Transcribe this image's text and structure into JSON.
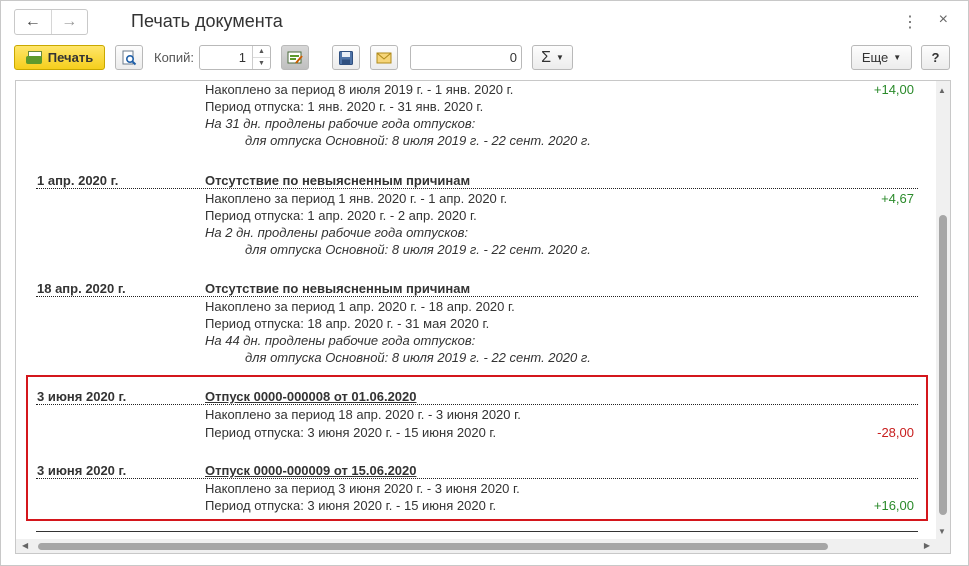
{
  "window": {
    "title": "Печать документа",
    "back_icon": "←",
    "forward_icon": "→",
    "more_icon": "⋮",
    "close_icon": "×"
  },
  "toolbar": {
    "print_label": "Печать",
    "copies_label": "Копий:",
    "copies_value": "1",
    "sum_value": "0",
    "sigma_label": "Σ",
    "more_label": "Еще",
    "help_label": "?"
  },
  "entries": [
    {
      "date": "",
      "title": "",
      "lines": [
        {
          "text": "Накоплено за период 8 июля 2019 г. - 1 янв. 2020 г.",
          "italic": false
        },
        {
          "text": "Период отпуска: 1 янв. 2020 г. - 31 янв. 2020 г.",
          "italic": false
        },
        {
          "text": "На 31 дн. продлены рабочие года отпусков:",
          "italic": true
        },
        {
          "text": "для отпуска Основной: 8 июля 2019 г. - 22 сент. 2020 г.",
          "italic": true
        }
      ],
      "amount": "+14,00"
    },
    {
      "date": "1 апр. 2020 г.",
      "title": "Отсутствие по невыясненным причинам",
      "lines": [
        {
          "text": "Накоплено за период 1 янв. 2020 г. - 1 апр. 2020 г.",
          "italic": false
        },
        {
          "text": "Период отпуска: 1 апр. 2020 г. - 2 апр. 2020 г.",
          "italic": false
        },
        {
          "text": "На 2 дн. продлены рабочие года отпусков:",
          "italic": true
        },
        {
          "text": "для отпуска Основной: 8 июля 2019 г. - 22 сент. 2020 г.",
          "italic": true
        }
      ],
      "amount": "+4,67"
    },
    {
      "date": "18 апр. 2020 г.",
      "title": "Отсутствие по невыясненным причинам",
      "lines": [
        {
          "text": "Накоплено за период 1 апр. 2020 г. - 18 апр. 2020 г.",
          "italic": false
        },
        {
          "text": "Период отпуска: 18 апр. 2020 г. - 31 мая 2020 г.",
          "italic": false
        },
        {
          "text": "На 44 дн. продлены рабочие года отпусков:",
          "italic": true
        },
        {
          "text": "для отпуска Основной: 8 июля 2019 г. - 22 сент. 2020 г.",
          "italic": true
        }
      ],
      "amount": ""
    },
    {
      "date": "3 июня 2020 г.",
      "title": "Отпуск 0000-000008 от 01.06.2020",
      "lines": [
        {
          "text": "Накоплено за период 18 апр. 2020 г. - 3 июня 2020 г.",
          "italic": false
        },
        {
          "text": "Период отпуска: 3 июня 2020 г. - 15 июня 2020 г.",
          "italic": false
        }
      ],
      "amount": "-28,00"
    },
    {
      "date": "3 июня 2020 г.",
      "title": "Отпуск 0000-000009 от 15.06.2020",
      "lines": [
        {
          "text": "Накоплено за период 3 июня 2020 г. - 3 июня 2020 г.",
          "italic": false
        },
        {
          "text": "Период отпуска: 3 июня 2020 г. - 15 июня 2020 г.",
          "italic": false
        }
      ],
      "amount": "+16,00"
    }
  ],
  "colors": {
    "positive": "#2a8a2a",
    "negative": "#c81e1e",
    "highlight": "#d4161c",
    "print_button": "#f5cf1c"
  }
}
